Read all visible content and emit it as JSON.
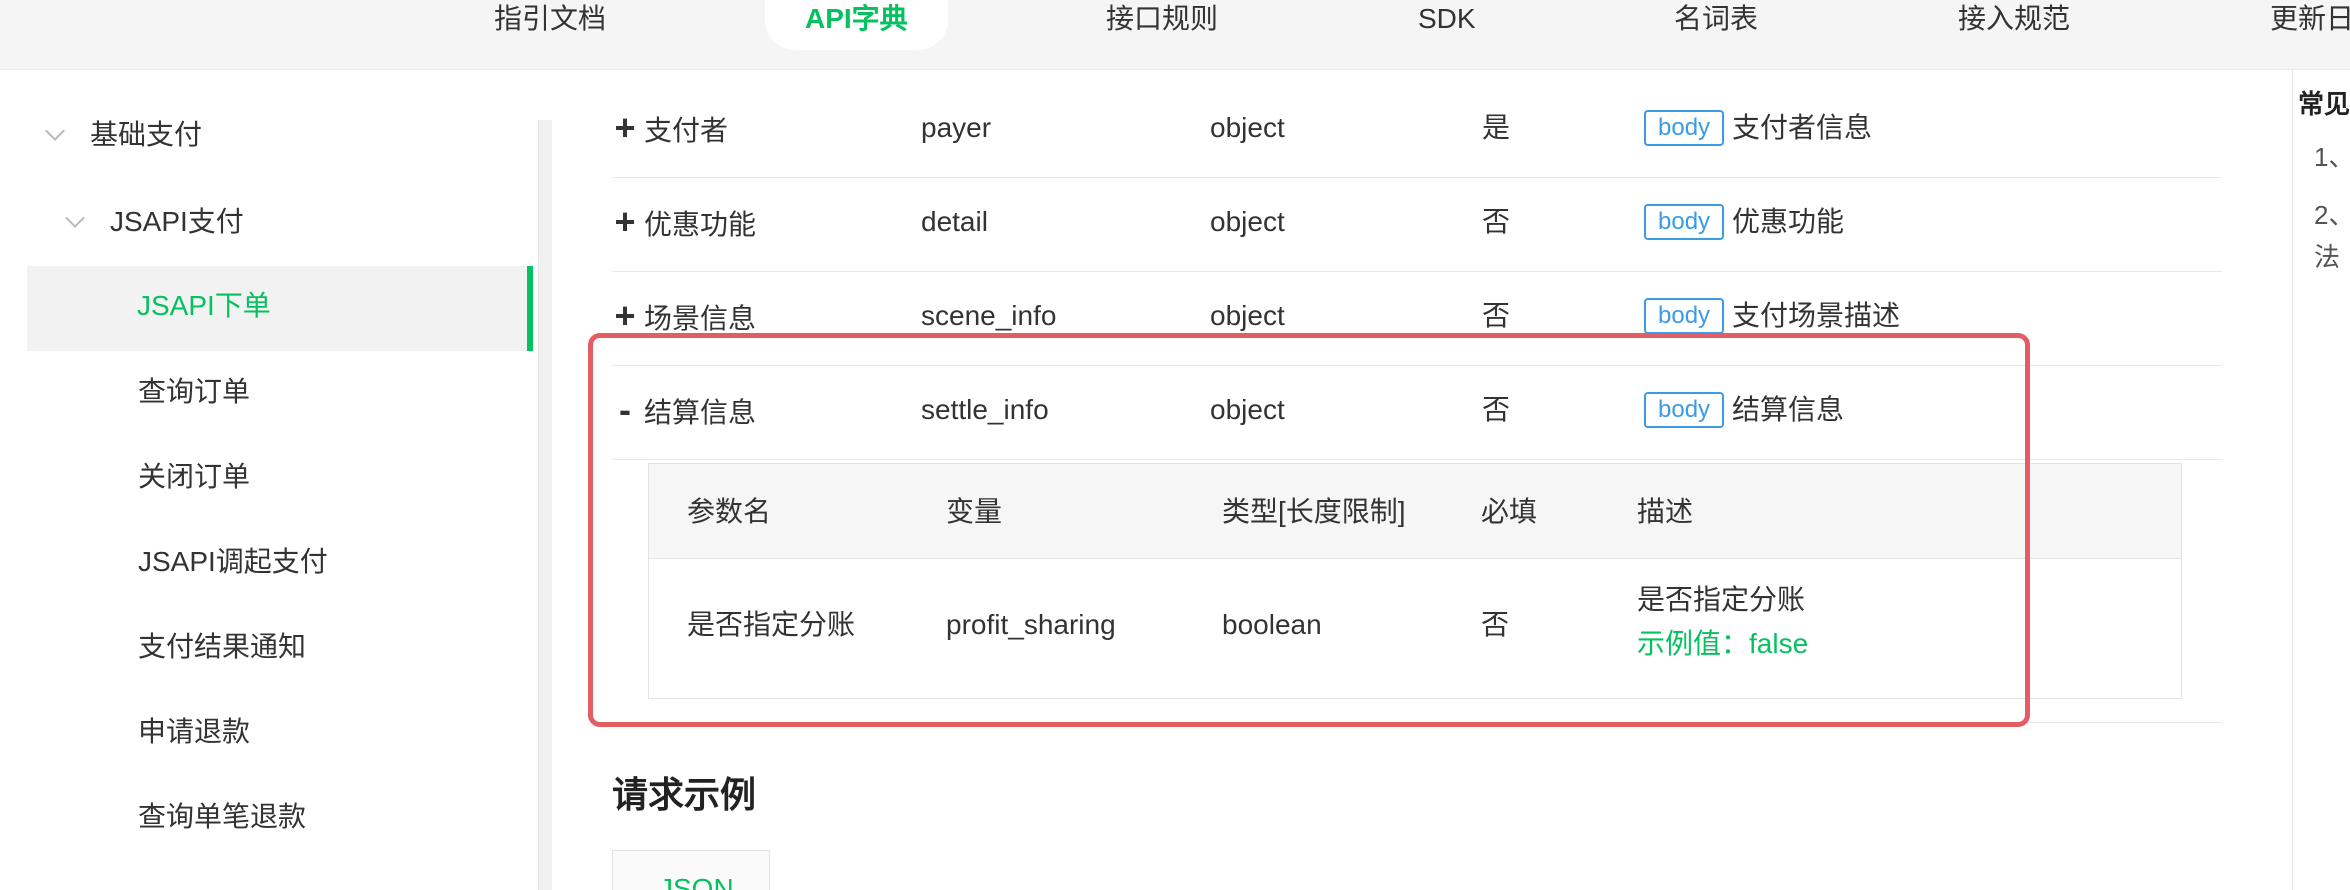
{
  "topnav": {
    "items": [
      "指引文档",
      "API字典",
      "接口规则",
      "SDK",
      "名词表",
      "接入规范",
      "更新日"
    ],
    "active_index": 1
  },
  "sidebar": {
    "group_label": "基础支付",
    "sub_group_label": "JSAPI支付",
    "active_item": "JSAPI下单",
    "items": [
      "查询订单",
      "关闭订单",
      "JSAPI调起支付",
      "支付结果通知",
      "申请退款",
      "查询单笔退款"
    ]
  },
  "params_table": {
    "rows": [
      {
        "toggle": "+",
        "name": "支付者",
        "variable": "payer",
        "type": "object",
        "required": "是",
        "tag": "body",
        "desc": "支付者信息"
      },
      {
        "toggle": "+",
        "name": "优惠功能",
        "variable": "detail",
        "type": "object",
        "required": "否",
        "tag": "body",
        "desc": "优惠功能"
      },
      {
        "toggle": "+",
        "name": "场景信息",
        "variable": "scene_info",
        "type": "object",
        "required": "否",
        "tag": "body",
        "desc": "支付场景描述"
      },
      {
        "toggle": "-",
        "name": "结算信息",
        "variable": "settle_info",
        "type": "object",
        "required": "否",
        "tag": "body",
        "desc": "结算信息"
      }
    ]
  },
  "nested_table": {
    "headers": [
      "参数名",
      "变量",
      "类型[长度限制]",
      "必填",
      "描述"
    ],
    "row": {
      "name": "是否指定分账",
      "variable": "profit_sharing",
      "type": "boolean",
      "required": "否",
      "desc": "是否指定分账",
      "example": "示例值：false"
    }
  },
  "request_example": {
    "title": "请求示例",
    "tab_label": "JSON"
  },
  "right_panel": {
    "title": "常见",
    "items": [
      "1、",
      "2、",
      "法"
    ]
  },
  "colors": {
    "accent": "#07c160",
    "tag_blue": "#3d9be3",
    "highlight_red": "#e35d63"
  }
}
